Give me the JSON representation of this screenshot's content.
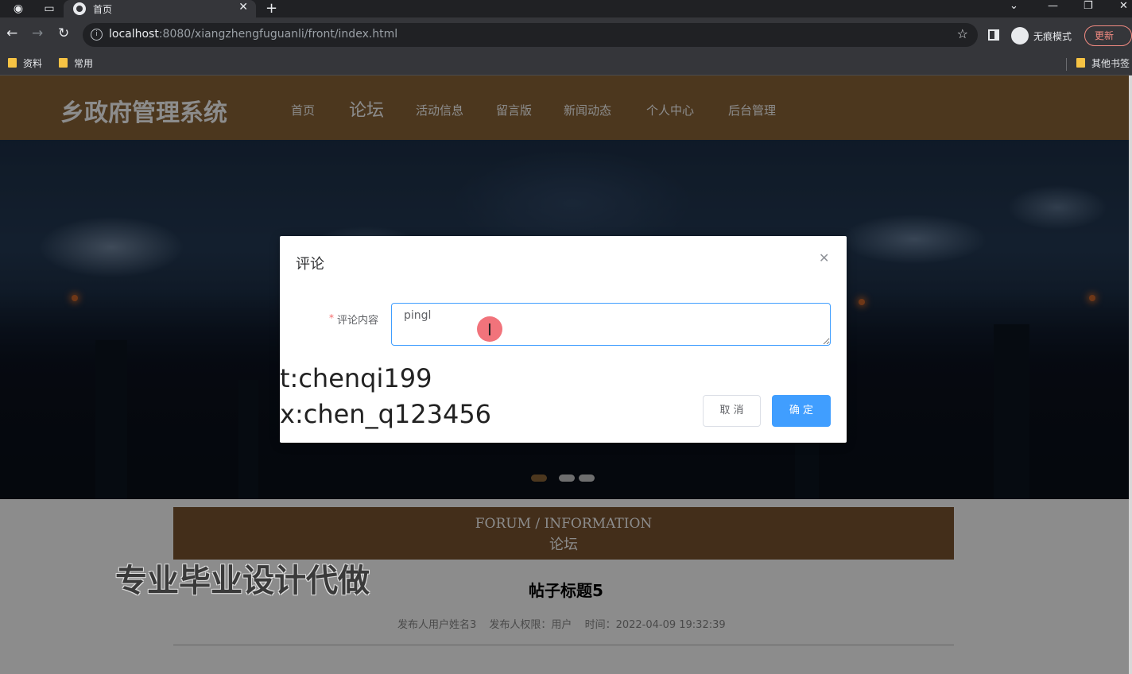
{
  "browser": {
    "tab_title": "首页",
    "url_host": "localhost",
    "url_rest": ":8080/xiangzhengfuguanli/front/index.html",
    "incognito_label": "无痕模式",
    "update_label": "更新",
    "bookmarks": [
      "资料",
      "常用"
    ],
    "other_bookmarks": "其他书签"
  },
  "site": {
    "logo": "乡政府管理系统",
    "nav": [
      "首页",
      "论坛",
      "活动信息",
      "留言版",
      "新闻动态",
      "个人中心",
      "后台管理"
    ],
    "active_nav": "论坛",
    "accent_color": "#8a6438"
  },
  "carousel": {
    "slide_count": 3,
    "active_index": 0
  },
  "section": {
    "title_en": "FORUM / INFORMATION",
    "title_cn": "论坛"
  },
  "post": {
    "title": "帖子标题5",
    "author": "发布人用户姓名3",
    "role": "发布人权限：用户",
    "time": "时间：2022-04-09 19:32:39"
  },
  "dialog": {
    "title": "评论",
    "required_mark": "*",
    "field_label": "评论内容",
    "field_value": "pingl",
    "cancel_label": "取 消",
    "confirm_label": "确 定"
  },
  "overlay_text": {
    "line1": "t:chenqi199",
    "line2": "x:chen_q123456",
    "watermark": "专业毕业设计代做"
  }
}
